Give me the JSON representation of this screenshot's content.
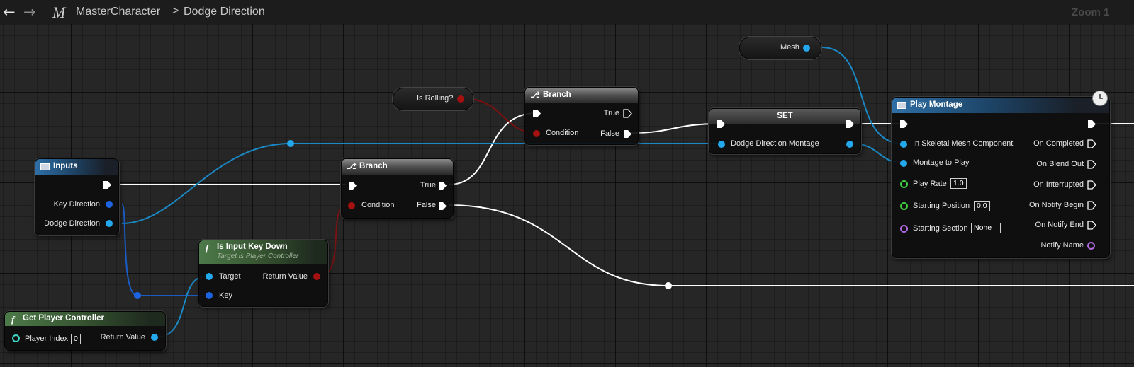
{
  "breadcrumb": {
    "root": "MasterCharacter",
    "separator": ">",
    "current": "Dodge Direction"
  },
  "zoom_label": "Zoom 1",
  "nodes": {
    "inputs": {
      "title": "Inputs",
      "pins": {
        "key_direction": "Key Direction",
        "dodge_direction": "Dodge Direction"
      }
    },
    "get_player_controller": {
      "title": "Get Player Controller",
      "player_index_label": "Player Index",
      "player_index_value": "0",
      "return_value": "Return Value"
    },
    "is_input_key_down": {
      "title": "Is Input Key Down",
      "subtitle": "Target is Player Controller",
      "target": "Target",
      "key": "Key",
      "return_value": "Return Value"
    },
    "branch_1": {
      "title": "Branch",
      "condition": "Condition",
      "true_label": "True",
      "false_label": "False"
    },
    "is_rolling": {
      "label": "Is Rolling?"
    },
    "branch_2": {
      "title": "Branch",
      "condition": "Condition",
      "true_label": "True",
      "false_label": "False"
    },
    "set": {
      "title": "SET",
      "var": "Dodge Direction Montage"
    },
    "mesh": {
      "label": "Mesh"
    },
    "play_montage": {
      "title": "Play Montage",
      "in_skeletal": "In Skeletal Mesh Component",
      "montage_to_play": "Montage to Play",
      "play_rate_label": "Play Rate",
      "play_rate_value": "1.0",
      "starting_position_label": "Starting Position",
      "starting_position_value": "0.0",
      "starting_section_label": "Starting Section",
      "starting_section_value": "None",
      "outputs": [
        "On Completed",
        "On Blend Out",
        "On Interrupted",
        "On Notify Begin",
        "On Notify End",
        "Notify Name"
      ]
    }
  },
  "colors": {
    "exec": "#ffffff",
    "object": "#24a8ec",
    "struct": "#1d64e0",
    "bool": "#a51010",
    "float": "#3fcf3f",
    "name": "#b06be0",
    "int": "#3ed6c0"
  }
}
